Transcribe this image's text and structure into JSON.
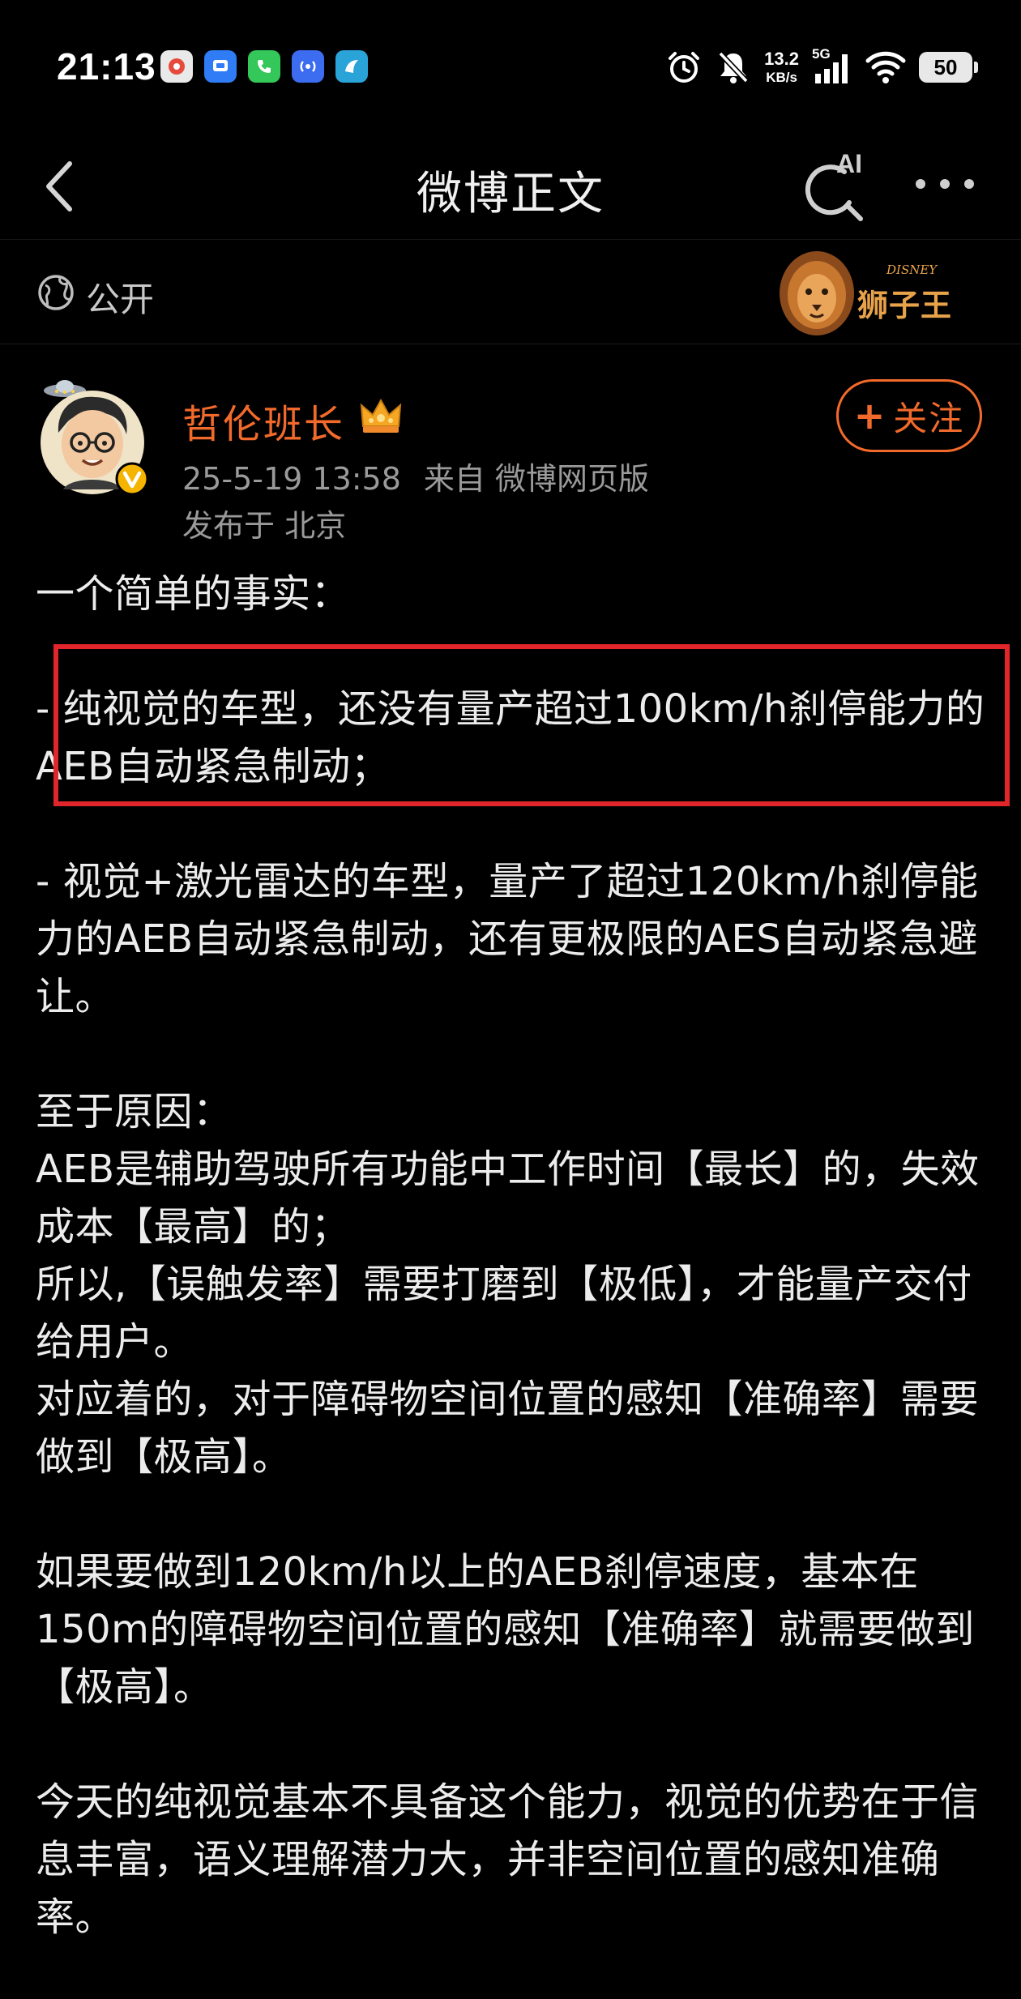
{
  "status_bar": {
    "time": "21:13",
    "net_speed_value": "13.2",
    "net_speed_unit": "KB/s",
    "network_type": "5G",
    "battery": "50"
  },
  "nav": {
    "title": "微博正文",
    "ai_label": "AI"
  },
  "visibility": {
    "label": "公开",
    "badge_text": "狮子王",
    "badge_brand": "DISNEY"
  },
  "author": {
    "name": "哲伦班长",
    "timestamp": "25-5-19 13:58",
    "source": "来自 微博网页版",
    "location": "发布于 北京",
    "follow_label": "关注",
    "follow_plus": "+"
  },
  "post": {
    "lines": [
      "一个简单的事实：",
      "",
      "- 纯视觉的车型，还没有量产超过100km/h刹停能力的AEB自动紧急制动；",
      "",
      "- 视觉+激光雷达的车型，量产了超过120km/h刹停能力的AEB自动紧急制动，还有更极限的AES自动紧急避让。",
      "",
      "至于原因：",
      "AEB是辅助驾驶所有功能中工作时间【最长】的，失效成本【最高】的；",
      "所以,【误触发率】需要打磨到【极低】，才能量产交付给用户。",
      "对应着的，对于障碍物空间位置的感知【准确率】需要做到【极高】。",
      "",
      "如果要做到120km/h以上的AEB刹停速度，基本在150m的障碍物空间位置的感知【准确率】就需要做到【极高】。",
      "",
      "今天的纯视觉基本不具备这个能力，视觉的优势在于信息丰富，语义理解潜力大，并非空间位置的感知准确率。"
    ]
  },
  "colors": {
    "accent": "#f26a2b",
    "highlight_border": "#e0262a",
    "background": "#000000",
    "text": "#ececec",
    "meta_text": "#9a9a9a"
  },
  "icons": {
    "back": "chevron-left-icon",
    "ai_search": "ai-search-icon",
    "more": "more-dots-icon",
    "globe": "globe-icon",
    "crown": "crown-icon",
    "verified": "verified-badge-icon"
  }
}
